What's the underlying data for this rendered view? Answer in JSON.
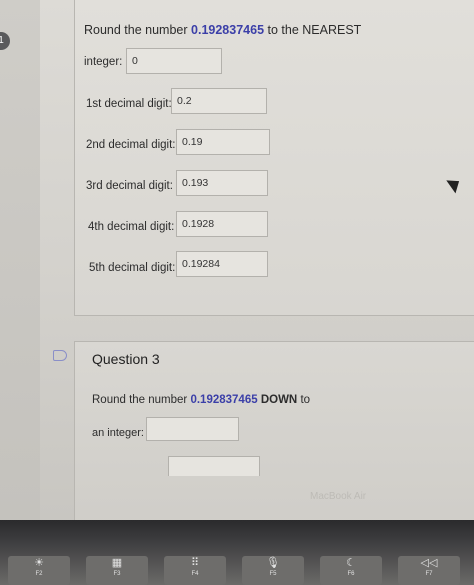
{
  "question1": {
    "number_badge": "1",
    "prompt_prefix": "Round the number",
    "prompt_number": "0.192837465",
    "prompt_suffix": "to the NEAREST",
    "rows": [
      {
        "label": "integer:",
        "value": "0"
      },
      {
        "label": "1st decimal digit:",
        "value": "0.2"
      },
      {
        "label": "2nd decimal digit:",
        "value": "0.19"
      },
      {
        "label": "3rd decimal digit:",
        "value": "0.193"
      },
      {
        "label": "4th decimal digit:",
        "value": "0.1928"
      },
      {
        "label": "5th decimal digit:",
        "value": "0.19284"
      }
    ]
  },
  "question3": {
    "title": "Question 3",
    "prompt_prefix": "Round the number",
    "prompt_number": "0.192837465",
    "prompt_direction": "DOWN",
    "prompt_suffix": "to",
    "integer_label": "an integer:",
    "integer_value": ""
  },
  "laptop": {
    "brand": "MacBook Air",
    "keys": [
      {
        "symbol": "☀",
        "fkey": "F2"
      },
      {
        "symbol": "▦",
        "fkey": "F3"
      },
      {
        "symbol": "⠿",
        "fkey": "F4"
      },
      {
        "symbol": "🎙",
        "fkey": "F5"
      },
      {
        "symbol": "☾",
        "fkey": "F6"
      },
      {
        "symbol": "◁◁",
        "fkey": "F7"
      }
    ]
  }
}
